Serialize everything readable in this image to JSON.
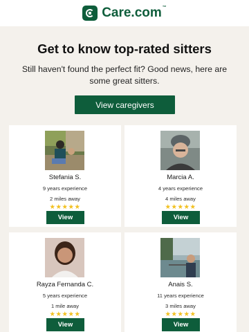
{
  "header": {
    "brand": "Care.com",
    "tm": "™"
  },
  "hero": {
    "title": "Get to know top-rated sitters",
    "subtitle": "Still haven't found the perfect fit? Good news, here are some great sitters.",
    "cta_label": "View caregivers"
  },
  "caregivers": [
    {
      "name": "Stefania S.",
      "experience": "9 years experience",
      "distance": "2 miles away",
      "stars": "★★★★★",
      "rating": 5,
      "view_label": "View"
    },
    {
      "name": "Marcia A.",
      "experience": "4 years experience",
      "distance": "4 miles away",
      "stars": "★★★★★",
      "rating": 5,
      "view_label": "View"
    },
    {
      "name": "Rayza Fernanda C.",
      "experience": "5 years experience",
      "distance": "1 mile away",
      "stars": "★★★★★",
      "rating": 5,
      "view_label": "View"
    },
    {
      "name": "Anais S.",
      "experience": "11 years experience",
      "distance": "3 miles away",
      "stars": "★★★★★",
      "rating": 5,
      "view_label": "View"
    }
  ],
  "colors": {
    "brand_green": "#0e5d3b",
    "star_yellow": "#f2c01e",
    "background": "#f4f1ec"
  }
}
